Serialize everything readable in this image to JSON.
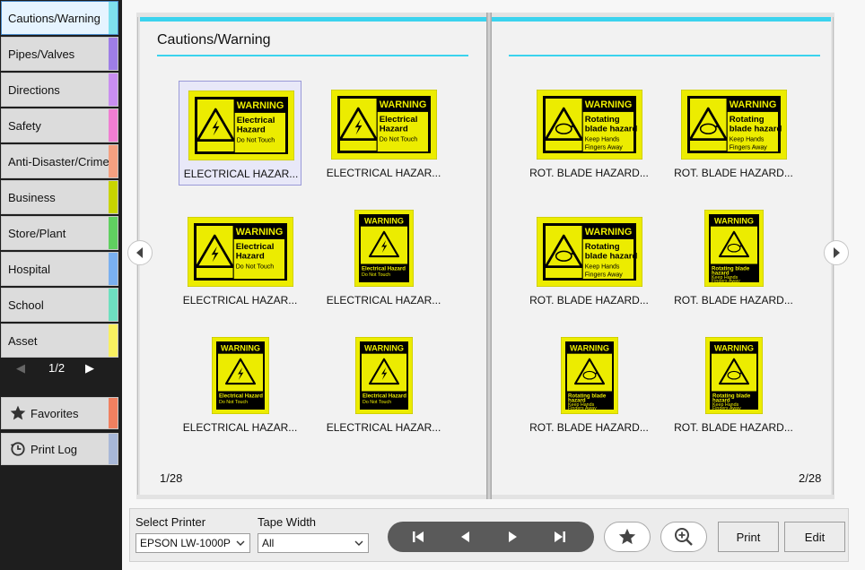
{
  "sidebar": {
    "categories": [
      {
        "label": "Cautions/Warning",
        "color": "#7ee0ee",
        "active": true
      },
      {
        "label": "Pipes/Valves",
        "color": "#9e7ee6"
      },
      {
        "label": "Directions",
        "color": "#c98ef0"
      },
      {
        "label": "Safety",
        "color": "#f07ed2"
      },
      {
        "label": "Anti-Disaster/Crime",
        "color": "#f4a080"
      },
      {
        "label": "Business",
        "color": "#c8d400"
      },
      {
        "label": "Store/Plant",
        "color": "#60d060"
      },
      {
        "label": "Hospital",
        "color": "#7ab0f0"
      },
      {
        "label": "School",
        "color": "#6ee0c0"
      },
      {
        "label": "Asset",
        "color": "#f8f060"
      }
    ],
    "pager": {
      "prev": "◀",
      "current": "1/2",
      "next": "▶"
    },
    "favorites_label": "Favorites",
    "favorites_color": "#f08060",
    "print_log_label": "Print Log",
    "print_log_color": "#a8b8d8"
  },
  "book": {
    "left_title": "Cautions/Warning",
    "left_page_number": "1/28",
    "right_page_number": "2/28",
    "accent_color": "#3bd3ee",
    "sign_yellow": "#ecec00",
    "left_items": [
      {
        "label": "ELECTRICAL HAZAR...",
        "kind": "electrical-landscape",
        "selected": true,
        "header": "WARNING",
        "l1": "Electrical",
        "l2": "Hazard",
        "l3": "Do Not Touch"
      },
      {
        "label": "ELECTRICAL HAZAR...",
        "kind": "electrical-landscape",
        "header": "WARNING",
        "l1": "Electrical",
        "l2": "Hazard",
        "l3": "Do Not Touch"
      },
      {
        "label": "ELECTRICAL HAZAR...",
        "kind": "electrical-landscape",
        "header": "WARNING",
        "l1": "Electrical",
        "l2": "Hazard",
        "l3": "Do Not Touch"
      },
      {
        "label": "ELECTRICAL HAZAR...",
        "kind": "electrical-portrait",
        "header": "WARNING",
        "l1": "Electrical Hazard",
        "l3": "Do Not Touch"
      },
      {
        "label": "ELECTRICAL HAZAR...",
        "kind": "electrical-portrait-small",
        "header": "WARNING",
        "l1": "Electrical Hazard",
        "l3": "Do Not Touch"
      },
      {
        "label": "ELECTRICAL HAZAR...",
        "kind": "electrical-portrait-small",
        "header": "WARNING",
        "l1": "Electrical Hazard",
        "l3": "Do Not Touch"
      }
    ],
    "right_items": [
      {
        "label": "ROT. BLADE HAZARD...",
        "kind": "blade-landscape",
        "header": "WARNING",
        "l1": "Rotating",
        "l2": "blade hazard",
        "l3": "Keep Hands",
        "l4": "Fingers Away"
      },
      {
        "label": "ROT. BLADE HAZARD...",
        "kind": "blade-landscape",
        "header": "WARNING",
        "l1": "Rotating",
        "l2": "blade hazard",
        "l3": "Keep Hands",
        "l4": "Fingers Away"
      },
      {
        "label": "ROT. BLADE HAZARD...",
        "kind": "blade-landscape",
        "header": "WARNING",
        "l1": "Rotating",
        "l2": "blade hazard",
        "l3": "Keep Hands",
        "l4": "Fingers Away"
      },
      {
        "label": "ROT. BLADE HAZARD...",
        "kind": "blade-portrait",
        "header": "WARNING",
        "l1": "Rotating blade",
        "l2": "hazard",
        "l3": "Keep Hands",
        "l4": "Fingers Away"
      },
      {
        "label": "ROT. BLADE HAZARD...",
        "kind": "blade-portrait-small",
        "header": "WARNING",
        "l1": "Rotating blade",
        "l2": "hazard",
        "l3": "Keep Hands",
        "l4": "Fingers Away"
      },
      {
        "label": "ROT. BLADE HAZARD...",
        "kind": "blade-portrait-small",
        "header": "WARNING",
        "l1": "Rotating blade",
        "l2": "hazard",
        "l3": "Keep Hands",
        "l4": "Fingers Away"
      }
    ]
  },
  "bottom": {
    "printer_label": "Select Printer",
    "printer_value": "EPSON LW-1000P",
    "tape_label": "Tape Width",
    "tape_value": "All",
    "print_label": "Print",
    "edit_label": "Edit"
  }
}
